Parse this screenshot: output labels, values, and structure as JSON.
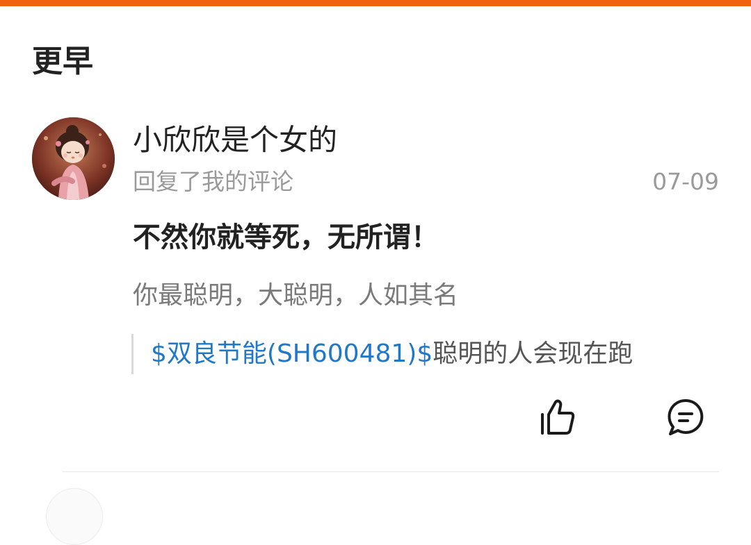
{
  "section": {
    "heading": "更早"
  },
  "notification": {
    "username": "小欣欣是个女的",
    "action": "回复了我的评论",
    "date": "07-09",
    "reply": "不然你就等死，无所谓！",
    "original_comment": "你最聪明，大聪明，人如其名",
    "quote": {
      "stock_link": "$双良节能(SH600481)$",
      "text": "聪明的人会现在跑"
    },
    "icons": {
      "like": "thumbs-up-icon",
      "comment": "comment-icon"
    }
  },
  "colors": {
    "accent": "#f0620e",
    "link": "#1f78c8",
    "muted_text": "#9a9a9a",
    "primary_text": "#222222"
  }
}
